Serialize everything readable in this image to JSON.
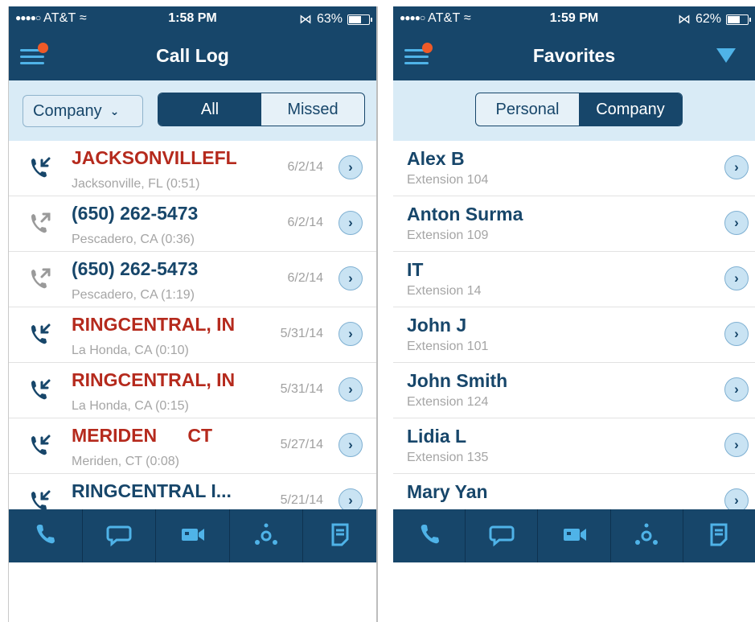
{
  "left_screen": {
    "status": {
      "carrier": "AT&T",
      "time": "1:58 PM",
      "battery": "63%",
      "battery_level": 0.63
    },
    "title": "Call Log",
    "filter_dropdown": "Company",
    "segments": [
      "All",
      "Missed"
    ],
    "selected_segment": "All",
    "calls": [
      {
        "name": "JACKSONVILLEFL",
        "detail": "Jacksonville, FL (0:51)",
        "date": "6/2/14",
        "type": "incoming",
        "style": "red"
      },
      {
        "name": "(650) 262-5473",
        "detail": "Pescadero, CA (0:36)",
        "date": "6/2/14",
        "type": "outgoing",
        "style": "dark"
      },
      {
        "name": "(650) 262-5473",
        "detail": "Pescadero, CA (1:19)",
        "date": "6/2/14",
        "type": "outgoing",
        "style": "dark"
      },
      {
        "name": "RINGCENTRAL, IN",
        "detail": "La Honda, CA (0:10)",
        "date": "5/31/14",
        "type": "incoming",
        "style": "red"
      },
      {
        "name": "RINGCENTRAL, IN",
        "detail": "La Honda, CA (0:15)",
        "date": "5/31/14",
        "type": "incoming",
        "style": "red"
      },
      {
        "name": "MERIDEN      CT",
        "detail": "Meriden, CT (0:08)",
        "date": "5/27/14",
        "type": "incoming",
        "style": "red"
      },
      {
        "name": "RINGCENTRAL I...",
        "detail": "",
        "date": "5/21/14",
        "type": "incoming",
        "style": "dark"
      }
    ]
  },
  "right_screen": {
    "status": {
      "carrier": "AT&T",
      "time": "1:59 PM",
      "battery": "62%",
      "battery_level": 0.62
    },
    "title": "Favorites",
    "segments": [
      "Personal",
      "Company"
    ],
    "selected_segment": "Company",
    "favorites": [
      {
        "name": "Alex B",
        "extension": "Extension 104"
      },
      {
        "name": "Anton Surma",
        "extension": "Extension 109"
      },
      {
        "name": "IT",
        "extension": "Extension 14"
      },
      {
        "name": "John J",
        "extension": "Extension 101"
      },
      {
        "name": "John Smith",
        "extension": "Extension 124"
      },
      {
        "name": "Lidia L",
        "extension": "Extension 135"
      },
      {
        "name": "Mary Yan",
        "extension": ""
      }
    ]
  },
  "tabs": [
    {
      "name": "phone-icon"
    },
    {
      "name": "message-icon"
    },
    {
      "name": "video-icon"
    },
    {
      "name": "conference-icon"
    },
    {
      "name": "fax-icon"
    }
  ],
  "colors": {
    "navy": "#17466a",
    "accent_blue": "#4fb3e8",
    "missed_red": "#b52a1d",
    "notification_orange": "#ef5a28",
    "segment_bg": "#d9ebf6"
  }
}
